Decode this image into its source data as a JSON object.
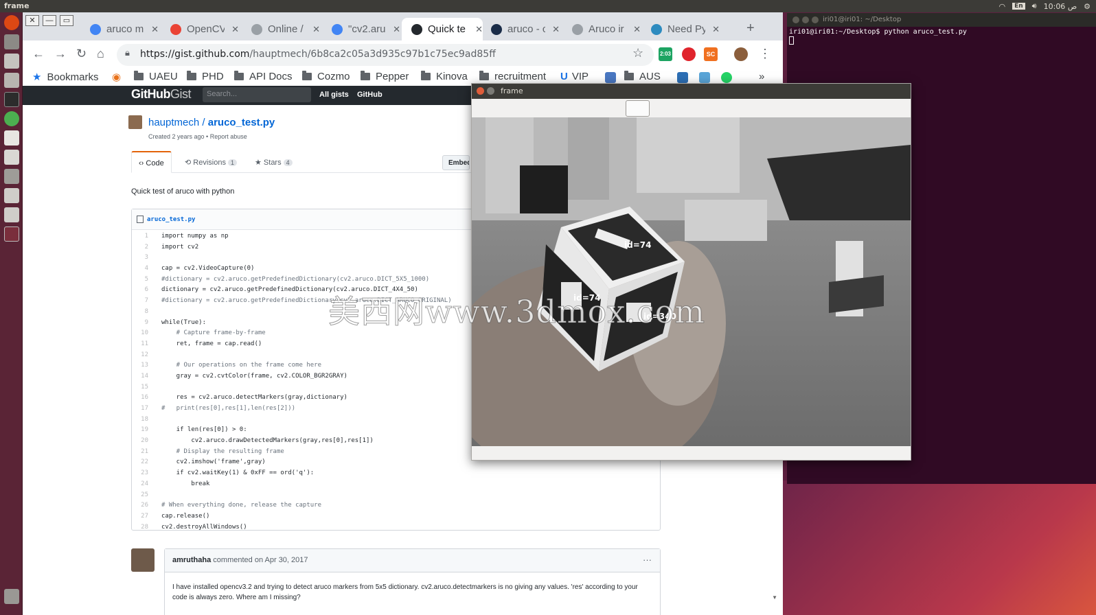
{
  "topbar": {
    "title": "frame",
    "lang": "En",
    "clock": "10:06 ص"
  },
  "terminal": {
    "title": "iri01@iri01: ~/Desktop",
    "prompt": "iri01@iri01:~/Desktop$ python aruco_test.py"
  },
  "browser": {
    "tabs": [
      {
        "label": "aruco m",
        "favicon_color": "#4285f4"
      },
      {
        "label": "OpenCV",
        "favicon_color": "#ea4335"
      },
      {
        "label": "Online /",
        "favicon_color": "#9aa0a6"
      },
      {
        "label": "\"cv2.aru",
        "favicon_color": "#4285f4"
      },
      {
        "label": "Quick te",
        "favicon_color": "#24292e"
      },
      {
        "label": "aruco - c",
        "favicon_color": "#1a2c48"
      },
      {
        "label": "Aruco ir",
        "favicon_color": "#9aa0a6"
      },
      {
        "label": "Need Py",
        "favicon_color": "#2d8bbf"
      }
    ],
    "url_host": "https://gist.github.com",
    "url_path": "/hauptmech/6b8ca2c05a3d935c97b1c75ec9ad85ff",
    "ext_badge": "2:03",
    "ext_sc": "SC",
    "bookmarks": [
      {
        "label": "Bookmarks",
        "type": "star"
      },
      {
        "label": "",
        "type": "eye"
      },
      {
        "label": "UAEU",
        "type": "folder"
      },
      {
        "label": "PHD",
        "type": "folder"
      },
      {
        "label": "API Docs",
        "type": "folder"
      },
      {
        "label": "Cozmo",
        "type": "folder"
      },
      {
        "label": "Pepper",
        "type": "folder"
      },
      {
        "label": "Kinova",
        "type": "folder"
      },
      {
        "label": "recruitment",
        "type": "folder"
      },
      {
        "label": "VIP",
        "type": "icon"
      },
      {
        "label": "AUS",
        "type": "folder"
      }
    ],
    "bookmarks_more": "»"
  },
  "gist": {
    "header": {
      "logo_bold": "GitHub",
      "logo_light": "Gist",
      "search_placeholder": "Search...",
      "link_all": "All gists",
      "link_github": "GitHub"
    },
    "owner": "hauptmech",
    "separator": " / ",
    "filename_title": "aruco_test.py",
    "created": "Created 2 years ago • Report abuse",
    "tabs": {
      "code": "Code",
      "revisions": "Revisions",
      "revisions_count": "1",
      "stars": "Stars",
      "stars_count": "4"
    },
    "embed": "Embed",
    "description": "Quick test of aruco with python",
    "file_name": "aruco_test.py",
    "code_lines": [
      "import numpy as np",
      "import cv2",
      "",
      "cap = cv2.VideoCapture(0)",
      "#dictionary = cv2.aruco.getPredefinedDictionary(cv2.aruco.DICT_5X5_1000)",
      "dictionary = cv2.aruco.getPredefinedDictionary(cv2.aruco.DICT_4X4_50)",
      "#dictionary = cv2.aruco.getPredefinedDictionary(cv2.aruco.DICT_ARUCO_ORIGINAL)",
      "",
      "while(True):",
      "    # Capture frame-by-frame",
      "    ret, frame = cap.read()",
      "",
      "    # Our operations on the frame come here",
      "    gray = cv2.cvtColor(frame, cv2.COLOR_BGR2GRAY)",
      "",
      "    res = cv2.aruco.detectMarkers(gray,dictionary)",
      "#   print(res[0],res[1],len(res[2]))",
      "",
      "    if len(res[0]) > 0:",
      "        cv2.aruco.drawDetectedMarkers(gray,res[0],res[1])",
      "    # Display the resulting frame",
      "    cv2.imshow('frame',gray)",
      "    if cv2.waitKey(1) & 0xFF == ord('q'):",
      "        break",
      "",
      "# When everything done, release the capture",
      "cap.release()",
      "cv2.destroyAllWindows()"
    ],
    "comment": {
      "author": "amruthaha",
      "meta": " commented on Apr 30, 2017",
      "more": "···",
      "body": "I have installed opencv3.2 and trying to detect aruco markers from 5x5 dictionary. cv2.aruco.detectmarkers is no giving any values. 'res' according to your code is always zero. Where am I missing?"
    }
  },
  "frame_window": {
    "title": "frame",
    "marker_labels": [
      "id=74",
      "id=74",
      "id=340"
    ]
  },
  "watermark": "美西网www.3dmox.com"
}
